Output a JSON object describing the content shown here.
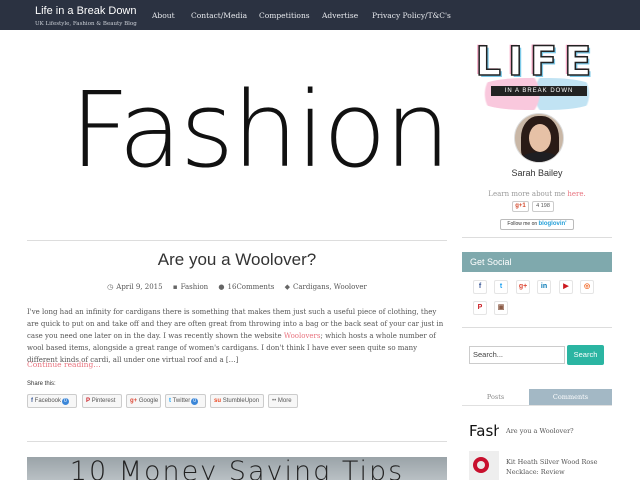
{
  "site": {
    "title": "Life in a Break Down",
    "tagline": "UK Lifestyle, Fashion & Beauty Blog"
  },
  "nav": {
    "items": [
      {
        "label": "About"
      },
      {
        "label": "Contact/Media"
      },
      {
        "label": "Competitions"
      },
      {
        "label": "Advertise"
      },
      {
        "label": "Privacy Policy/T&C's"
      }
    ]
  },
  "post": {
    "hero_text": "Fashion",
    "title": "Are you a Woolover?",
    "date": "April 9, 2015",
    "category": "Fashion",
    "comments": "16Comments",
    "tags": "Cardigans, Woolover",
    "excerpt_before": "I've long had an infinity for cardigans there is something that makes them just such a useful piece of clothing, they are quick to put on and take off and they are often great from throwing into a bag or the back seat of your car just in case you need one later on in the day. I was recently shown the website ",
    "excerpt_link": "Woolovers",
    "excerpt_after": "; which hosts a whole number of wool based items, alongside a great range of women's cardigans. I don't think I have ever seen quite so many different kinds of cardi, all under one virtual roof and a […]",
    "read_more": "Continue reading…",
    "share_label": "Share this:",
    "share_buttons": [
      {
        "icon": "f",
        "label": "Facebook",
        "count": "0"
      },
      {
        "icon": "P",
        "label": "Pinterest",
        "count": ""
      },
      {
        "icon": "g+",
        "label": "Google",
        "count": ""
      },
      {
        "icon": "t",
        "label": "Twitter",
        "count": "0"
      },
      {
        "icon": "su",
        "label": "StumbleUpon",
        "count": ""
      },
      {
        "icon": "••",
        "label": "More",
        "count": ""
      }
    ]
  },
  "next_post": {
    "image_text": "10 Money Saving Tips"
  },
  "sidebar": {
    "logo_word": "LIFE",
    "logo_band": "IN A BREAK DOWN",
    "author_name": "Sarah Bailey",
    "learn_text": "Learn more about me ",
    "learn_link": "here.",
    "gplus_label": "g+1",
    "gplus_count": "4 198",
    "bloglovin_prefix": "Follow me on ",
    "bloglovin_brand": "bloglovin'",
    "social_heading": "Get Social",
    "social_icons": [
      {
        "name": "facebook",
        "glyph": "f",
        "color": "#3b5998"
      },
      {
        "name": "twitter",
        "glyph": "t",
        "color": "#1da1f2"
      },
      {
        "name": "google-plus",
        "glyph": "g+",
        "color": "#dd4b39"
      },
      {
        "name": "linkedin",
        "glyph": "in",
        "color": "#0077b5"
      },
      {
        "name": "youtube",
        "glyph": "▶",
        "color": "#cc181e"
      },
      {
        "name": "rss",
        "glyph": "◎",
        "color": "#f26522"
      },
      {
        "name": "pinterest",
        "glyph": "P",
        "color": "#cb2027"
      },
      {
        "name": "instagram",
        "glyph": "▣",
        "color": "#8a5a44"
      }
    ],
    "search_placeholder": "Search...",
    "search_button": "Search",
    "tabs": {
      "posts": "Posts",
      "comments": "Comments"
    },
    "popular": [
      {
        "thumb_text": "Fashio",
        "title": "Are you a Woolover?"
      },
      {
        "thumb_text": "",
        "title": "Kit Heath Silver Wood Rose Necklace: Review"
      }
    ]
  },
  "colors": {
    "nav_bg": "#2b3241",
    "accent_link": "#e8737f",
    "social_header": "#7fa9ad",
    "search_button": "#2bb5a2"
  }
}
